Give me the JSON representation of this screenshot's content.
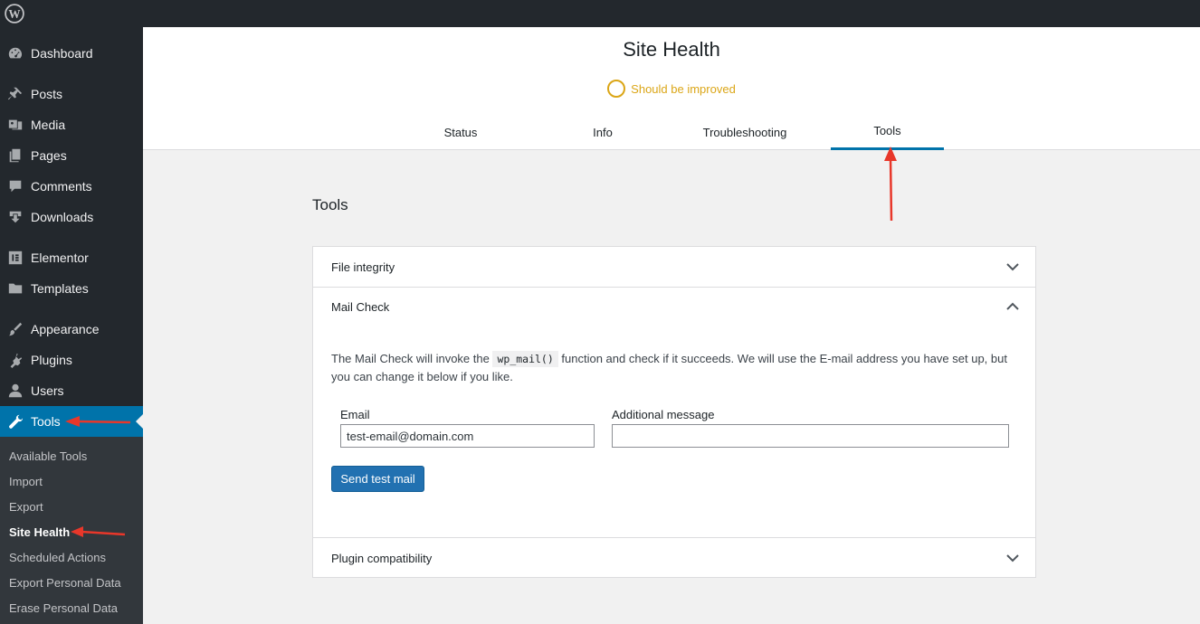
{
  "sidebar": {
    "items": [
      {
        "label": "Dashboard",
        "icon": "dashboard-icon"
      },
      {
        "label": "Posts",
        "icon": "pin-icon"
      },
      {
        "label": "Media",
        "icon": "media-icon"
      },
      {
        "label": "Pages",
        "icon": "pages-icon"
      },
      {
        "label": "Comments",
        "icon": "comment-icon"
      },
      {
        "label": "Downloads",
        "icon": "download-icon"
      },
      {
        "label": "Elementor",
        "icon": "elementor-icon"
      },
      {
        "label": "Templates",
        "icon": "folder-icon"
      },
      {
        "label": "Appearance",
        "icon": "paintbrush-icon"
      },
      {
        "label": "Plugins",
        "icon": "plugin-icon"
      },
      {
        "label": "Users",
        "icon": "user-icon"
      },
      {
        "label": "Tools",
        "icon": "wrench-icon"
      }
    ],
    "submenu": [
      "Available Tools",
      "Import",
      "Export",
      "Site Health",
      "Scheduled Actions",
      "Export Personal Data",
      "Erase Personal Data"
    ]
  },
  "header": {
    "title": "Site Health",
    "status": "Should be improved",
    "tabs": [
      "Status",
      "Info",
      "Troubleshooting",
      "Tools"
    ]
  },
  "main": {
    "section_title": "Tools",
    "accordion": {
      "file_integrity": "File integrity",
      "mail_check": "Mail Check",
      "plugin_compat": "Plugin compatibility",
      "desc_before": "The Mail Check will invoke the ",
      "desc_code": "wp_mail()",
      "desc_after": " function and check if it succeeds. We will use the E-mail address you have set up, but you can change it below if you like.",
      "email_label": "Email",
      "email_value": "test-email@domain.com",
      "message_label": "Additional message",
      "message_value": "",
      "send_button": "Send test mail"
    }
  },
  "colors": {
    "accent": "#0073aa",
    "warning": "#dba617",
    "annotation_arrow": "#e8372a"
  }
}
